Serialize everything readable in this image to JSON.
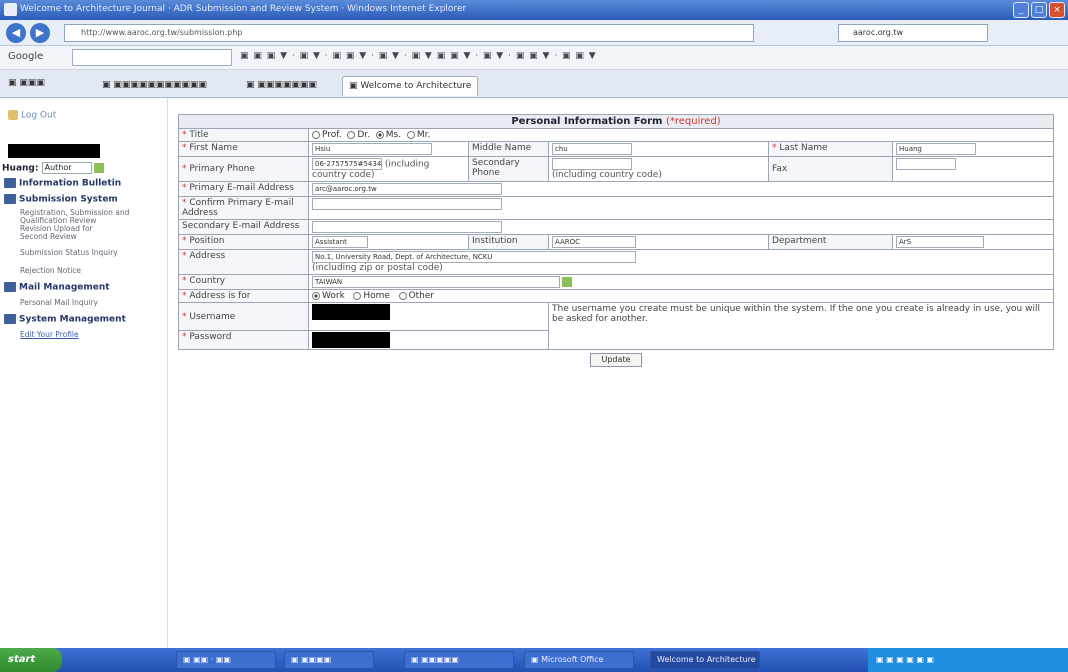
{
  "browser": {
    "title": "Welcome to Architecture Journal · ADR Submission and Review System · Windows Internet Explorer",
    "url": "http://www.aaroc.org.tw/submission.php",
    "search_value": "aaroc.org.tw",
    "google_label": "Google",
    "toolbar_text": "▣ ▣ ▣ ▼ · ▣ ▼ · ▣ ▣ ▼ · ▣ ▼ · ▣ ▼ ▣ ▣ ▼ · ▣ ▼ · ▣ ▣ ▼ · ▣ ▣ ▼",
    "favorites_label": "▣ ▣▣▣",
    "tabs": [
      {
        "label": "▣ ▣▣▣▣▣▣▣▣▣▣▣"
      },
      {
        "label": "▣ ▣▣▣▣▣▣▣"
      },
      {
        "label": "▣ Welcome to Architecture"
      }
    ]
  },
  "sidebar": {
    "logout": "Log Out",
    "user_prefix": "Huang:",
    "user_role": "Author",
    "sections": [
      {
        "title": "Information Bulletin",
        "items": []
      },
      {
        "title": "Submission System",
        "items": [
          "Registration, Submission and",
          "Qualification Review",
          "Revision Upload for",
          "Second Review",
          "Submission Status Inquiry",
          "Rejection Notice"
        ]
      },
      {
        "title": "Mail Management",
        "items": [
          "Personal Mail Inquiry"
        ]
      },
      {
        "title": "System Management",
        "items": [
          "Edit Your Profile"
        ]
      }
    ]
  },
  "form": {
    "title": "Personal Information Form",
    "required_note": "(*required)",
    "title_label": "Title",
    "title_options": [
      "Prof.",
      "Dr.",
      "Ms.",
      "Mr."
    ],
    "title_selected": "Ms.",
    "first_name_label": "First Name",
    "first_name_value": "Hsiu",
    "middle_name_label": "Middle Name",
    "middle_name_value": "chu",
    "last_name_label": "Last Name",
    "last_name_value": "Huang",
    "primary_phone_label": "Primary Phone",
    "primary_phone_value": "06-2757575#54341",
    "primary_phone_hint": "(including country code)",
    "secondary_phone_label": "Secondary Phone",
    "secondary_phone_hint": "(including country code)",
    "fax_label": "Fax",
    "primary_email_label": "Primary E-mail Address",
    "primary_email_value": "arc@aaroc.org.tw",
    "confirm_email_label": "Confirm Primary E-mail Address",
    "secondary_email_label": "Secondary E-mail Address",
    "position_label": "Position",
    "position_value": "Assistant",
    "institution_label": "Institution",
    "institution_value": "AAROC",
    "department_label": "Department",
    "department_value": "ArS",
    "address_label": "Address",
    "address_value": "No.1, University Road, Dept. of Architecture, NCKU",
    "address_hint": "(including zip or postal code)",
    "country_label": "Country",
    "country_value": "TAIWAN",
    "address_is_for_label": "Address is for",
    "address_is_for_options": [
      "Work",
      "Home",
      "Other"
    ],
    "address_is_for_selected": "Work",
    "username_label": "Username",
    "password_label": "Password",
    "username_note": "The username you create must be unique within the system. If the one you create is already in use, you will be asked for another.",
    "update_label": "Update"
  },
  "taskbar": {
    "start_label": "start",
    "tasks": [
      "▣ ▣▣ · ▣▣",
      "▣ ▣▣▣▣",
      "▣ ▣▣▣▣▣",
      "▣ Microsoft Office",
      "Welcome to Architecture"
    ],
    "tray_text": "▣ ▣ ▣ ▣ ▣ ▣"
  }
}
